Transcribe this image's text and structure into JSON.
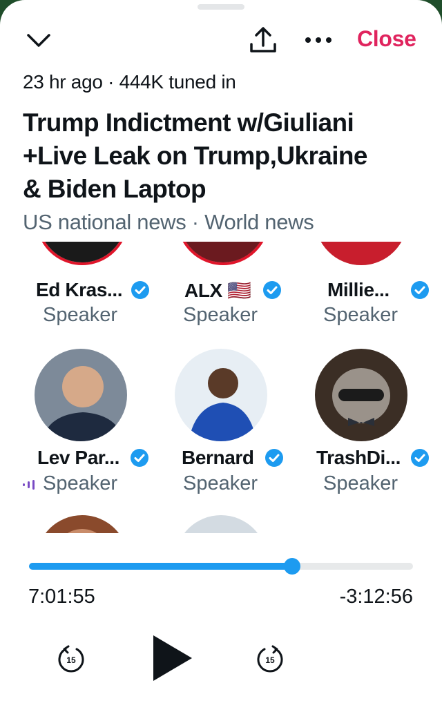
{
  "header": {
    "close_label": "Close",
    "icons": [
      "chevron-down-icon",
      "share-icon",
      "more-icon"
    ]
  },
  "space": {
    "meta": "23 hr ago · 444K tuned in",
    "title_lines": [
      "Trump Indictment w/Giuliani",
      "+Live Leak on Trump,Ukraine",
      "& Biden Laptop"
    ],
    "topics": "US national news · World news"
  },
  "speakers": [
    {
      "name": "Ed Kras...",
      "role": "Speaker",
      "verified": true
    },
    {
      "name": "ALX 🇺🇸",
      "role": "Speaker",
      "verified": true
    },
    {
      "name": "Millie...",
      "role": "Speaker",
      "verified": true
    },
    {
      "name": "Lev Par...",
      "role": "Speaker",
      "verified": true,
      "speaking": true
    },
    {
      "name": "Bernard",
      "role": "Speaker",
      "verified": true
    },
    {
      "name": "TrashDi...",
      "role": "Speaker",
      "verified": true
    }
  ],
  "player": {
    "elapsed": "7:01:55",
    "remaining": "-3:12:56",
    "progress_fraction": 0.685,
    "rewind_label": "15",
    "forward_label": "15"
  },
  "colors": {
    "accent": "#1d9bf0",
    "close": "#e0245e",
    "text": "#0f1419",
    "muted": "#536471"
  }
}
